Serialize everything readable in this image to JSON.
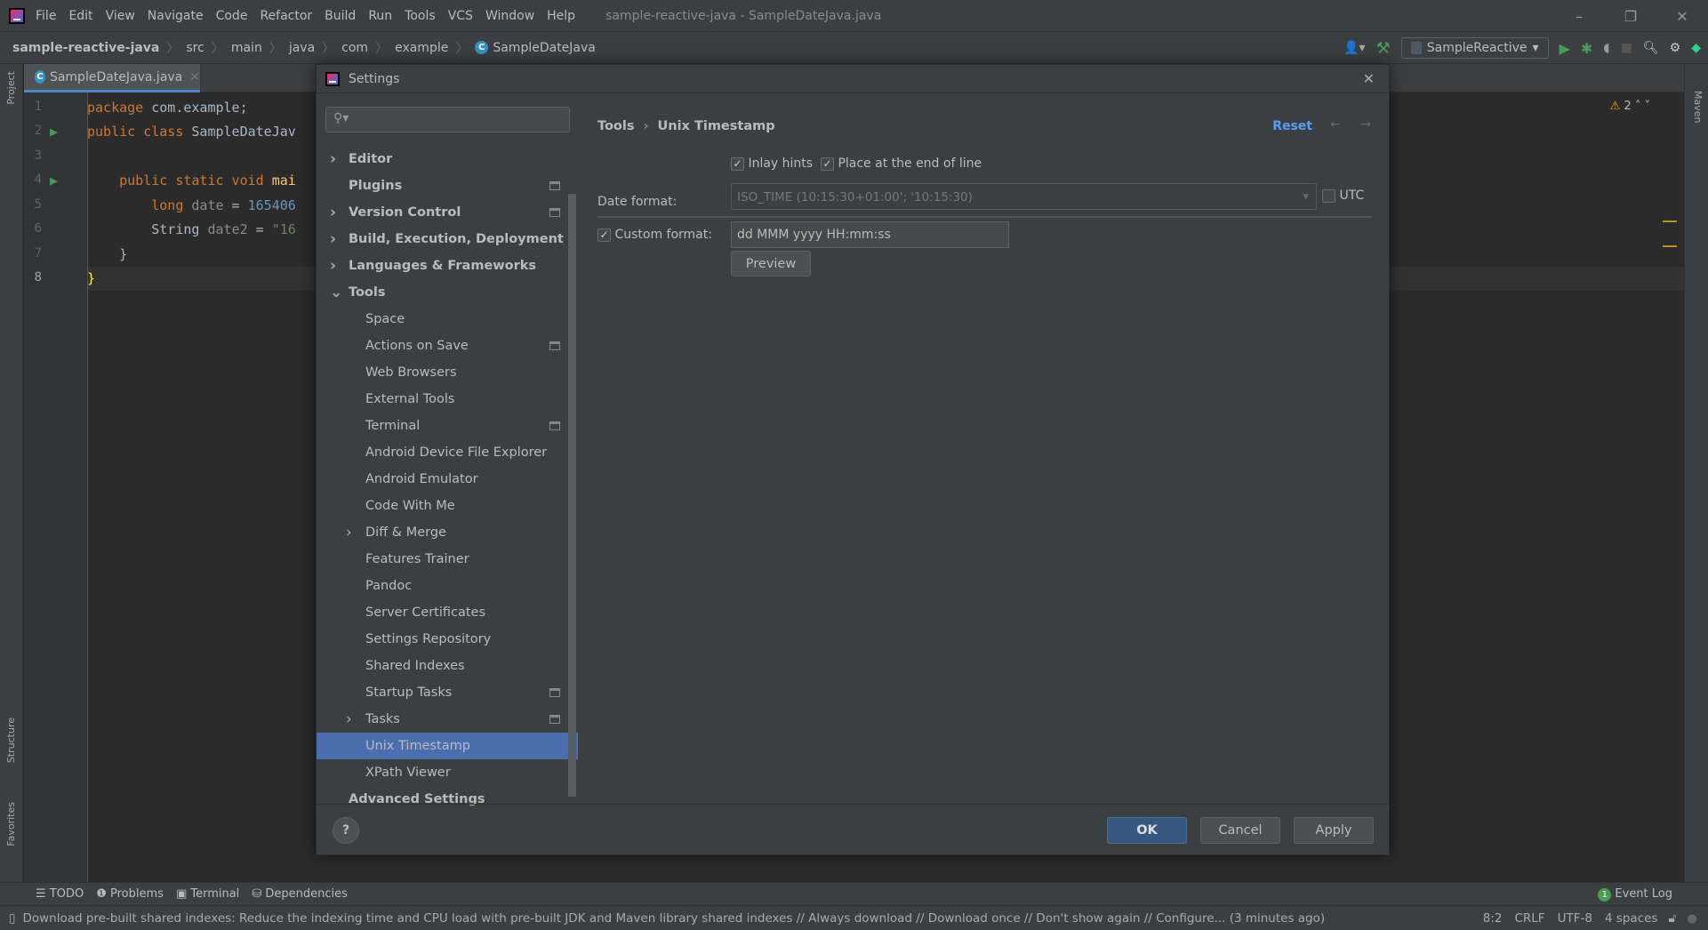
{
  "window": {
    "title": "sample-reactive-java - SampleDateJava.java",
    "menu": [
      "File",
      "Edit",
      "View",
      "Navigate",
      "Code",
      "Refactor",
      "Build",
      "Run",
      "Tools",
      "VCS",
      "Window",
      "Help"
    ],
    "controls": [
      "–",
      "❐",
      "✕"
    ]
  },
  "breadcrumb": [
    "sample-reactive-java",
    "src",
    "main",
    "java",
    "com",
    "example",
    "SampleDateJava"
  ],
  "toolbar": {
    "run_config": "SampleReactive"
  },
  "side": {
    "project": "Project",
    "structure": "Structure",
    "favorites": "Favorites",
    "maven": "Maven"
  },
  "editor": {
    "tab": "SampleDateJava.java",
    "warnings": "2",
    "lines": [
      "1",
      "2",
      "3",
      "4",
      "5",
      "6",
      "7",
      "8"
    ]
  },
  "code": {
    "l1a": "package",
    "l1b": " com.example;",
    "l2a": "public class",
    "l2b": " SampleDateJav",
    "l4a": "    public static void",
    "l4b": " mai",
    "l5a": "        long",
    "l5b": " date",
    "l5c": " = ",
    "l5d": "165406",
    "l6a": "        String",
    "l6b": " date2",
    "l6c": " = ",
    "l6d": "\"16",
    "l7": "    }",
    "l8": "}"
  },
  "dialog": {
    "title": "Settings",
    "tree": [
      {
        "label": "Editor",
        "bold": true,
        "chevron": ">",
        "level": 0
      },
      {
        "label": "Plugins",
        "bold": true,
        "level": 0,
        "badge": true
      },
      {
        "label": "Version Control",
        "bold": true,
        "chevron": ">",
        "level": 0,
        "badge": true
      },
      {
        "label": "Build, Execution, Deployment",
        "bold": true,
        "chevron": ">",
        "level": 0
      },
      {
        "label": "Languages & Frameworks",
        "bold": true,
        "chevron": ">",
        "level": 0
      },
      {
        "label": "Tools",
        "bold": true,
        "chevron": "v",
        "level": 0
      },
      {
        "label": "Space",
        "level": 1
      },
      {
        "label": "Actions on Save",
        "level": 1,
        "badge": true
      },
      {
        "label": "Web Browsers",
        "level": 1
      },
      {
        "label": "External Tools",
        "level": 1
      },
      {
        "label": "Terminal",
        "level": 1,
        "badge": true
      },
      {
        "label": "Android Device File Explorer",
        "level": 1
      },
      {
        "label": "Android Emulator",
        "level": 1
      },
      {
        "label": "Code With Me",
        "level": 1
      },
      {
        "label": "Diff & Merge",
        "level": 1,
        "chevron": ">"
      },
      {
        "label": "Features Trainer",
        "level": 1
      },
      {
        "label": "Pandoc",
        "level": 1
      },
      {
        "label": "Server Certificates",
        "level": 1
      },
      {
        "label": "Settings Repository",
        "level": 1
      },
      {
        "label": "Shared Indexes",
        "level": 1
      },
      {
        "label": "Startup Tasks",
        "level": 1,
        "badge": true
      },
      {
        "label": "Tasks",
        "level": 1,
        "chevron": ">",
        "badge": true
      },
      {
        "label": "Unix Timestamp",
        "level": 1,
        "selected": true
      },
      {
        "label": "XPath Viewer",
        "level": 1
      },
      {
        "label": "Advanced Settings",
        "bold": true,
        "level": 0
      }
    ],
    "crumb_parent": "Tools",
    "crumb_current": "Unix Timestamp",
    "reset": "Reset",
    "inlay_hints": {
      "label": "Inlay hints",
      "checked": true
    },
    "end_of_line": {
      "label": "Place at the end of line",
      "checked": true
    },
    "date_format_label": "Date format:",
    "date_format_value": "ISO_TIME (10:15:30+01:00'; '10:15:30)",
    "utc": {
      "label": "UTC",
      "checked": false
    },
    "custom_format": {
      "label": "Custom format:",
      "checked": true,
      "value": "dd MMM yyyy HH:mm:ss"
    },
    "preview": "Preview",
    "ok": "OK",
    "cancel": "Cancel",
    "apply": "Apply",
    "help": "?"
  },
  "toolwindows": [
    "TODO",
    "Problems",
    "Terminal",
    "Dependencies"
  ],
  "event_log": {
    "label": "Event Log",
    "count": "1"
  },
  "status": {
    "message": "Download pre-built shared indexes: Reduce the indexing time and CPU load with pre-built JDK and Maven library shared indexes // Always download // Download once // Don't show again // Configure... (3 minutes ago)",
    "position": "8:2",
    "line_sep": "CRLF",
    "encoding": "UTF-8",
    "indent": "4 spaces"
  },
  "colors": {
    "accent": "#4b6eaf",
    "link": "#589df6",
    "ok": "#365880",
    "keyword": "#cc7832",
    "number": "#6897bb",
    "string": "#6a8759"
  }
}
